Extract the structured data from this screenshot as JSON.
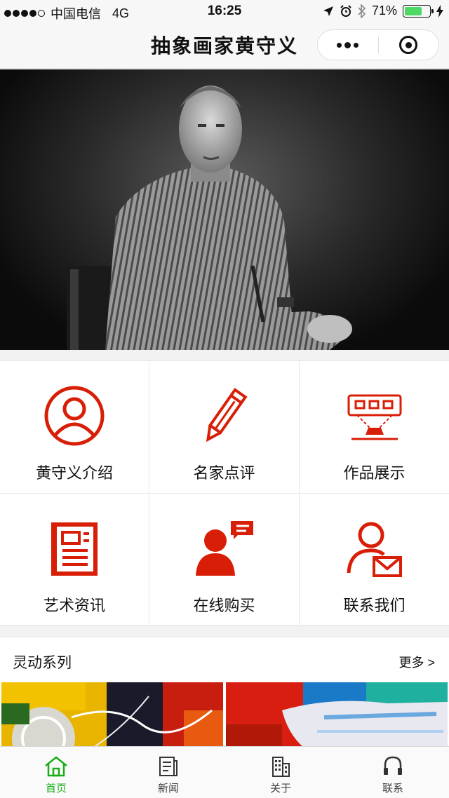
{
  "status_bar": {
    "carrier": "中国电信",
    "network": "4G",
    "time": "16:25",
    "battery": "71%",
    "battery_level": 0.71
  },
  "nav": {
    "title": "抽象画家黄守义"
  },
  "grid": [
    {
      "label": "黄守义介绍",
      "icon": "person-circle-icon"
    },
    {
      "label": "名家点评",
      "icon": "pencil-icon"
    },
    {
      "label": "作品展示",
      "icon": "projector-icon"
    },
    {
      "label": "艺术资讯",
      "icon": "newspaper-icon"
    },
    {
      "label": "在线购买",
      "icon": "user-chat-icon"
    },
    {
      "label": "联系我们",
      "icon": "user-mail-icon"
    }
  ],
  "section": {
    "title": "灵动系列",
    "more": "更多 >"
  },
  "tabs": [
    {
      "label": "首页",
      "icon": "home-icon",
      "active": true
    },
    {
      "label": "新闻",
      "icon": "news-icon",
      "active": false
    },
    {
      "label": "关于",
      "icon": "building-icon",
      "active": false
    },
    {
      "label": "联系",
      "icon": "headset-icon",
      "active": false
    }
  ],
  "colors": {
    "accent_red": "#d81e06",
    "tab_active": "#1aad19",
    "battery_green": "#4cd964"
  }
}
